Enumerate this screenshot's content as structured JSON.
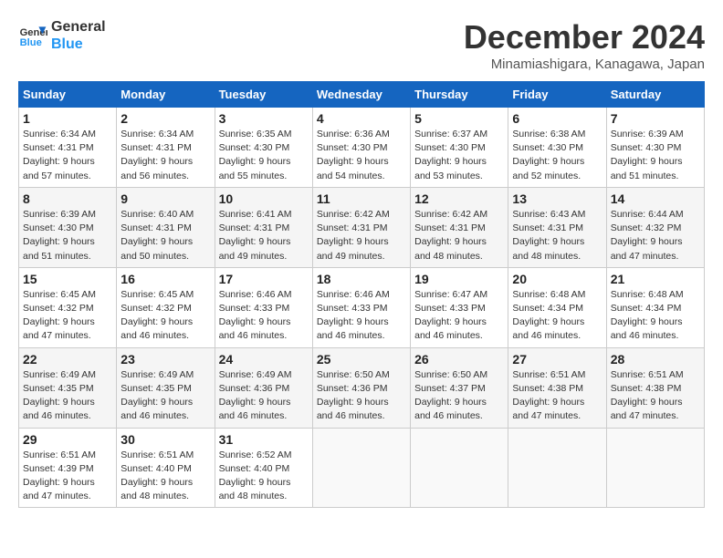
{
  "logo": {
    "line1": "General",
    "line2": "Blue"
  },
  "title": "December 2024",
  "location": "Minamiashigara, Kanagawa, Japan",
  "days_of_week": [
    "Sunday",
    "Monday",
    "Tuesday",
    "Wednesday",
    "Thursday",
    "Friday",
    "Saturday"
  ],
  "weeks": [
    [
      {
        "day": "1",
        "sunrise": "6:34 AM",
        "sunset": "4:31 PM",
        "daylight": "9 hours and 57 minutes."
      },
      {
        "day": "2",
        "sunrise": "6:34 AM",
        "sunset": "4:31 PM",
        "daylight": "9 hours and 56 minutes."
      },
      {
        "day": "3",
        "sunrise": "6:35 AM",
        "sunset": "4:30 PM",
        "daylight": "9 hours and 55 minutes."
      },
      {
        "day": "4",
        "sunrise": "6:36 AM",
        "sunset": "4:30 PM",
        "daylight": "9 hours and 54 minutes."
      },
      {
        "day": "5",
        "sunrise": "6:37 AM",
        "sunset": "4:30 PM",
        "daylight": "9 hours and 53 minutes."
      },
      {
        "day": "6",
        "sunrise": "6:38 AM",
        "sunset": "4:30 PM",
        "daylight": "9 hours and 52 minutes."
      },
      {
        "day": "7",
        "sunrise": "6:39 AM",
        "sunset": "4:30 PM",
        "daylight": "9 hours and 51 minutes."
      }
    ],
    [
      {
        "day": "8",
        "sunrise": "6:39 AM",
        "sunset": "4:30 PM",
        "daylight": "9 hours and 51 minutes."
      },
      {
        "day": "9",
        "sunrise": "6:40 AM",
        "sunset": "4:31 PM",
        "daylight": "9 hours and 50 minutes."
      },
      {
        "day": "10",
        "sunrise": "6:41 AM",
        "sunset": "4:31 PM",
        "daylight": "9 hours and 49 minutes."
      },
      {
        "day": "11",
        "sunrise": "6:42 AM",
        "sunset": "4:31 PM",
        "daylight": "9 hours and 49 minutes."
      },
      {
        "day": "12",
        "sunrise": "6:42 AM",
        "sunset": "4:31 PM",
        "daylight": "9 hours and 48 minutes."
      },
      {
        "day": "13",
        "sunrise": "6:43 AM",
        "sunset": "4:31 PM",
        "daylight": "9 hours and 48 minutes."
      },
      {
        "day": "14",
        "sunrise": "6:44 AM",
        "sunset": "4:32 PM",
        "daylight": "9 hours and 47 minutes."
      }
    ],
    [
      {
        "day": "15",
        "sunrise": "6:45 AM",
        "sunset": "4:32 PM",
        "daylight": "9 hours and 47 minutes."
      },
      {
        "day": "16",
        "sunrise": "6:45 AM",
        "sunset": "4:32 PM",
        "daylight": "9 hours and 46 minutes."
      },
      {
        "day": "17",
        "sunrise": "6:46 AM",
        "sunset": "4:33 PM",
        "daylight": "9 hours and 46 minutes."
      },
      {
        "day": "18",
        "sunrise": "6:46 AM",
        "sunset": "4:33 PM",
        "daylight": "9 hours and 46 minutes."
      },
      {
        "day": "19",
        "sunrise": "6:47 AM",
        "sunset": "4:33 PM",
        "daylight": "9 hours and 46 minutes."
      },
      {
        "day": "20",
        "sunrise": "6:48 AM",
        "sunset": "4:34 PM",
        "daylight": "9 hours and 46 minutes."
      },
      {
        "day": "21",
        "sunrise": "6:48 AM",
        "sunset": "4:34 PM",
        "daylight": "9 hours and 46 minutes."
      }
    ],
    [
      {
        "day": "22",
        "sunrise": "6:49 AM",
        "sunset": "4:35 PM",
        "daylight": "9 hours and 46 minutes."
      },
      {
        "day": "23",
        "sunrise": "6:49 AM",
        "sunset": "4:35 PM",
        "daylight": "9 hours and 46 minutes."
      },
      {
        "day": "24",
        "sunrise": "6:49 AM",
        "sunset": "4:36 PM",
        "daylight": "9 hours and 46 minutes."
      },
      {
        "day": "25",
        "sunrise": "6:50 AM",
        "sunset": "4:36 PM",
        "daylight": "9 hours and 46 minutes."
      },
      {
        "day": "26",
        "sunrise": "6:50 AM",
        "sunset": "4:37 PM",
        "daylight": "9 hours and 46 minutes."
      },
      {
        "day": "27",
        "sunrise": "6:51 AM",
        "sunset": "4:38 PM",
        "daylight": "9 hours and 47 minutes."
      },
      {
        "day": "28",
        "sunrise": "6:51 AM",
        "sunset": "4:38 PM",
        "daylight": "9 hours and 47 minutes."
      }
    ],
    [
      {
        "day": "29",
        "sunrise": "6:51 AM",
        "sunset": "4:39 PM",
        "daylight": "9 hours and 47 minutes."
      },
      {
        "day": "30",
        "sunrise": "6:51 AM",
        "sunset": "4:40 PM",
        "daylight": "9 hours and 48 minutes."
      },
      {
        "day": "31",
        "sunrise": "6:52 AM",
        "sunset": "4:40 PM",
        "daylight": "9 hours and 48 minutes."
      },
      null,
      null,
      null,
      null
    ]
  ]
}
